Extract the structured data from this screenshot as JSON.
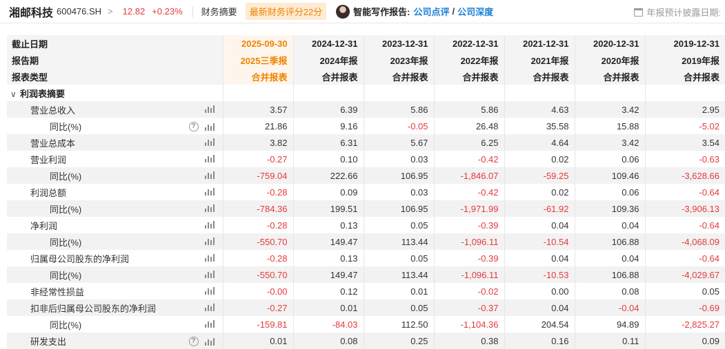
{
  "header": {
    "stock_name": "湘邮科技",
    "stock_code": "600476.SH",
    "chevron": ">",
    "price": "12.82",
    "change": "+0.23%",
    "menu_summary": "财务摘要",
    "score_badge": "最新财务评分22分",
    "ai_label": "智能写作报告:",
    "ai_link_1": "公司点评",
    "ai_slash": "/",
    "ai_link_2": "公司深度",
    "calendar_text": "年报预计披露日期:"
  },
  "table": {
    "head_labels": [
      "截止日期",
      "报告期",
      "报表类型"
    ],
    "columns": [
      {
        "date": "2025-09-30",
        "period": "2025三季报",
        "type": "合并报表",
        "current": true
      },
      {
        "date": "2024-12-31",
        "period": "2024年报",
        "type": "合并报表"
      },
      {
        "date": "2023-12-31",
        "period": "2023年报",
        "type": "合并报表"
      },
      {
        "date": "2022-12-31",
        "period": "2022年报",
        "type": "合并报表"
      },
      {
        "date": "2021-12-31",
        "period": "2021年报",
        "type": "合并报表"
      },
      {
        "date": "2020-12-31",
        "period": "2020年报",
        "type": "合并报表"
      },
      {
        "date": "2019-12-31",
        "period": "2019年报",
        "type": "合并报表"
      }
    ],
    "section_caret": "∨",
    "section_title": "利润表摘要",
    "rows": [
      {
        "label": "营业总收入",
        "level": 1,
        "help": false,
        "values": [
          "3.57",
          "6.39",
          "5.86",
          "5.86",
          "4.63",
          "3.42",
          "2.95"
        ]
      },
      {
        "label": "同比(%)",
        "level": 2,
        "help": true,
        "values": [
          "21.86",
          "9.16",
          "-0.05",
          "26.48",
          "35.58",
          "15.88",
          "-5.02"
        ]
      },
      {
        "label": "营业总成本",
        "level": 1,
        "help": false,
        "values": [
          "3.82",
          "6.31",
          "5.67",
          "6.25",
          "4.64",
          "3.42",
          "3.54"
        ]
      },
      {
        "label": "营业利润",
        "level": 1,
        "help": false,
        "values": [
          "-0.27",
          "0.10",
          "0.03",
          "-0.42",
          "0.02",
          "0.06",
          "-0.63"
        ]
      },
      {
        "label": "同比(%)",
        "level": 2,
        "help": false,
        "values": [
          "-759.04",
          "222.66",
          "106.95",
          "-1,846.07",
          "-59.25",
          "109.46",
          "-3,628.66"
        ]
      },
      {
        "label": "利润总额",
        "level": 1,
        "help": false,
        "values": [
          "-0.28",
          "0.09",
          "0.03",
          "-0.42",
          "0.02",
          "0.06",
          "-0.64"
        ]
      },
      {
        "label": "同比(%)",
        "level": 2,
        "help": false,
        "values": [
          "-784.36",
          "199.51",
          "106.95",
          "-1,971.99",
          "-61.92",
          "109.36",
          "-3,906.13"
        ]
      },
      {
        "label": "净利润",
        "level": 1,
        "help": false,
        "values": [
          "-0.28",
          "0.13",
          "0.05",
          "-0.39",
          "0.04",
          "0.04",
          "-0.64"
        ]
      },
      {
        "label": "同比(%)",
        "level": 2,
        "help": false,
        "values": [
          "-550.70",
          "149.47",
          "113.44",
          "-1,096.11",
          "-10.54",
          "106.88",
          "-4,068.09"
        ]
      },
      {
        "label": "归属母公司股东的净利润",
        "level": 1,
        "help": false,
        "values": [
          "-0.28",
          "0.13",
          "0.05",
          "-0.39",
          "0.04",
          "0.04",
          "-0.64"
        ]
      },
      {
        "label": "同比(%)",
        "level": 2,
        "help": false,
        "values": [
          "-550.70",
          "149.47",
          "113.44",
          "-1,096.11",
          "-10.53",
          "106.88",
          "-4,029.67"
        ]
      },
      {
        "label": "非经常性损益",
        "level": 1,
        "help": false,
        "values": [
          "-0.00",
          "0.12",
          "0.01",
          "-0.02",
          "0.00",
          "0.08",
          "0.05"
        ]
      },
      {
        "label": "扣非后归属母公司股东的净利润",
        "level": 1,
        "help": false,
        "values": [
          "-0.27",
          "0.01",
          "0.05",
          "-0.37",
          "0.04",
          "-0.04",
          "-0.69"
        ]
      },
      {
        "label": "同比(%)",
        "level": 2,
        "help": false,
        "values": [
          "-159.81",
          "-84.03",
          "112.50",
          "-1,104.36",
          "204.54",
          "94.89",
          "-2,825.27"
        ]
      },
      {
        "label": "研发支出",
        "level": 1,
        "help": true,
        "values": [
          "0.01",
          "0.08",
          "0.25",
          "0.38",
          "0.16",
          "0.11",
          "0.09"
        ]
      }
    ]
  },
  "icons": {
    "calendar": "calendar-icon",
    "chart": "bar-chart-icon",
    "help": "help-circle-icon",
    "help_glyph": "?",
    "caret": "chevron-down-icon"
  },
  "colors": {
    "negative": "#e4393c",
    "accent_orange": "#f08300",
    "link_blue": "#1a7fd4"
  }
}
